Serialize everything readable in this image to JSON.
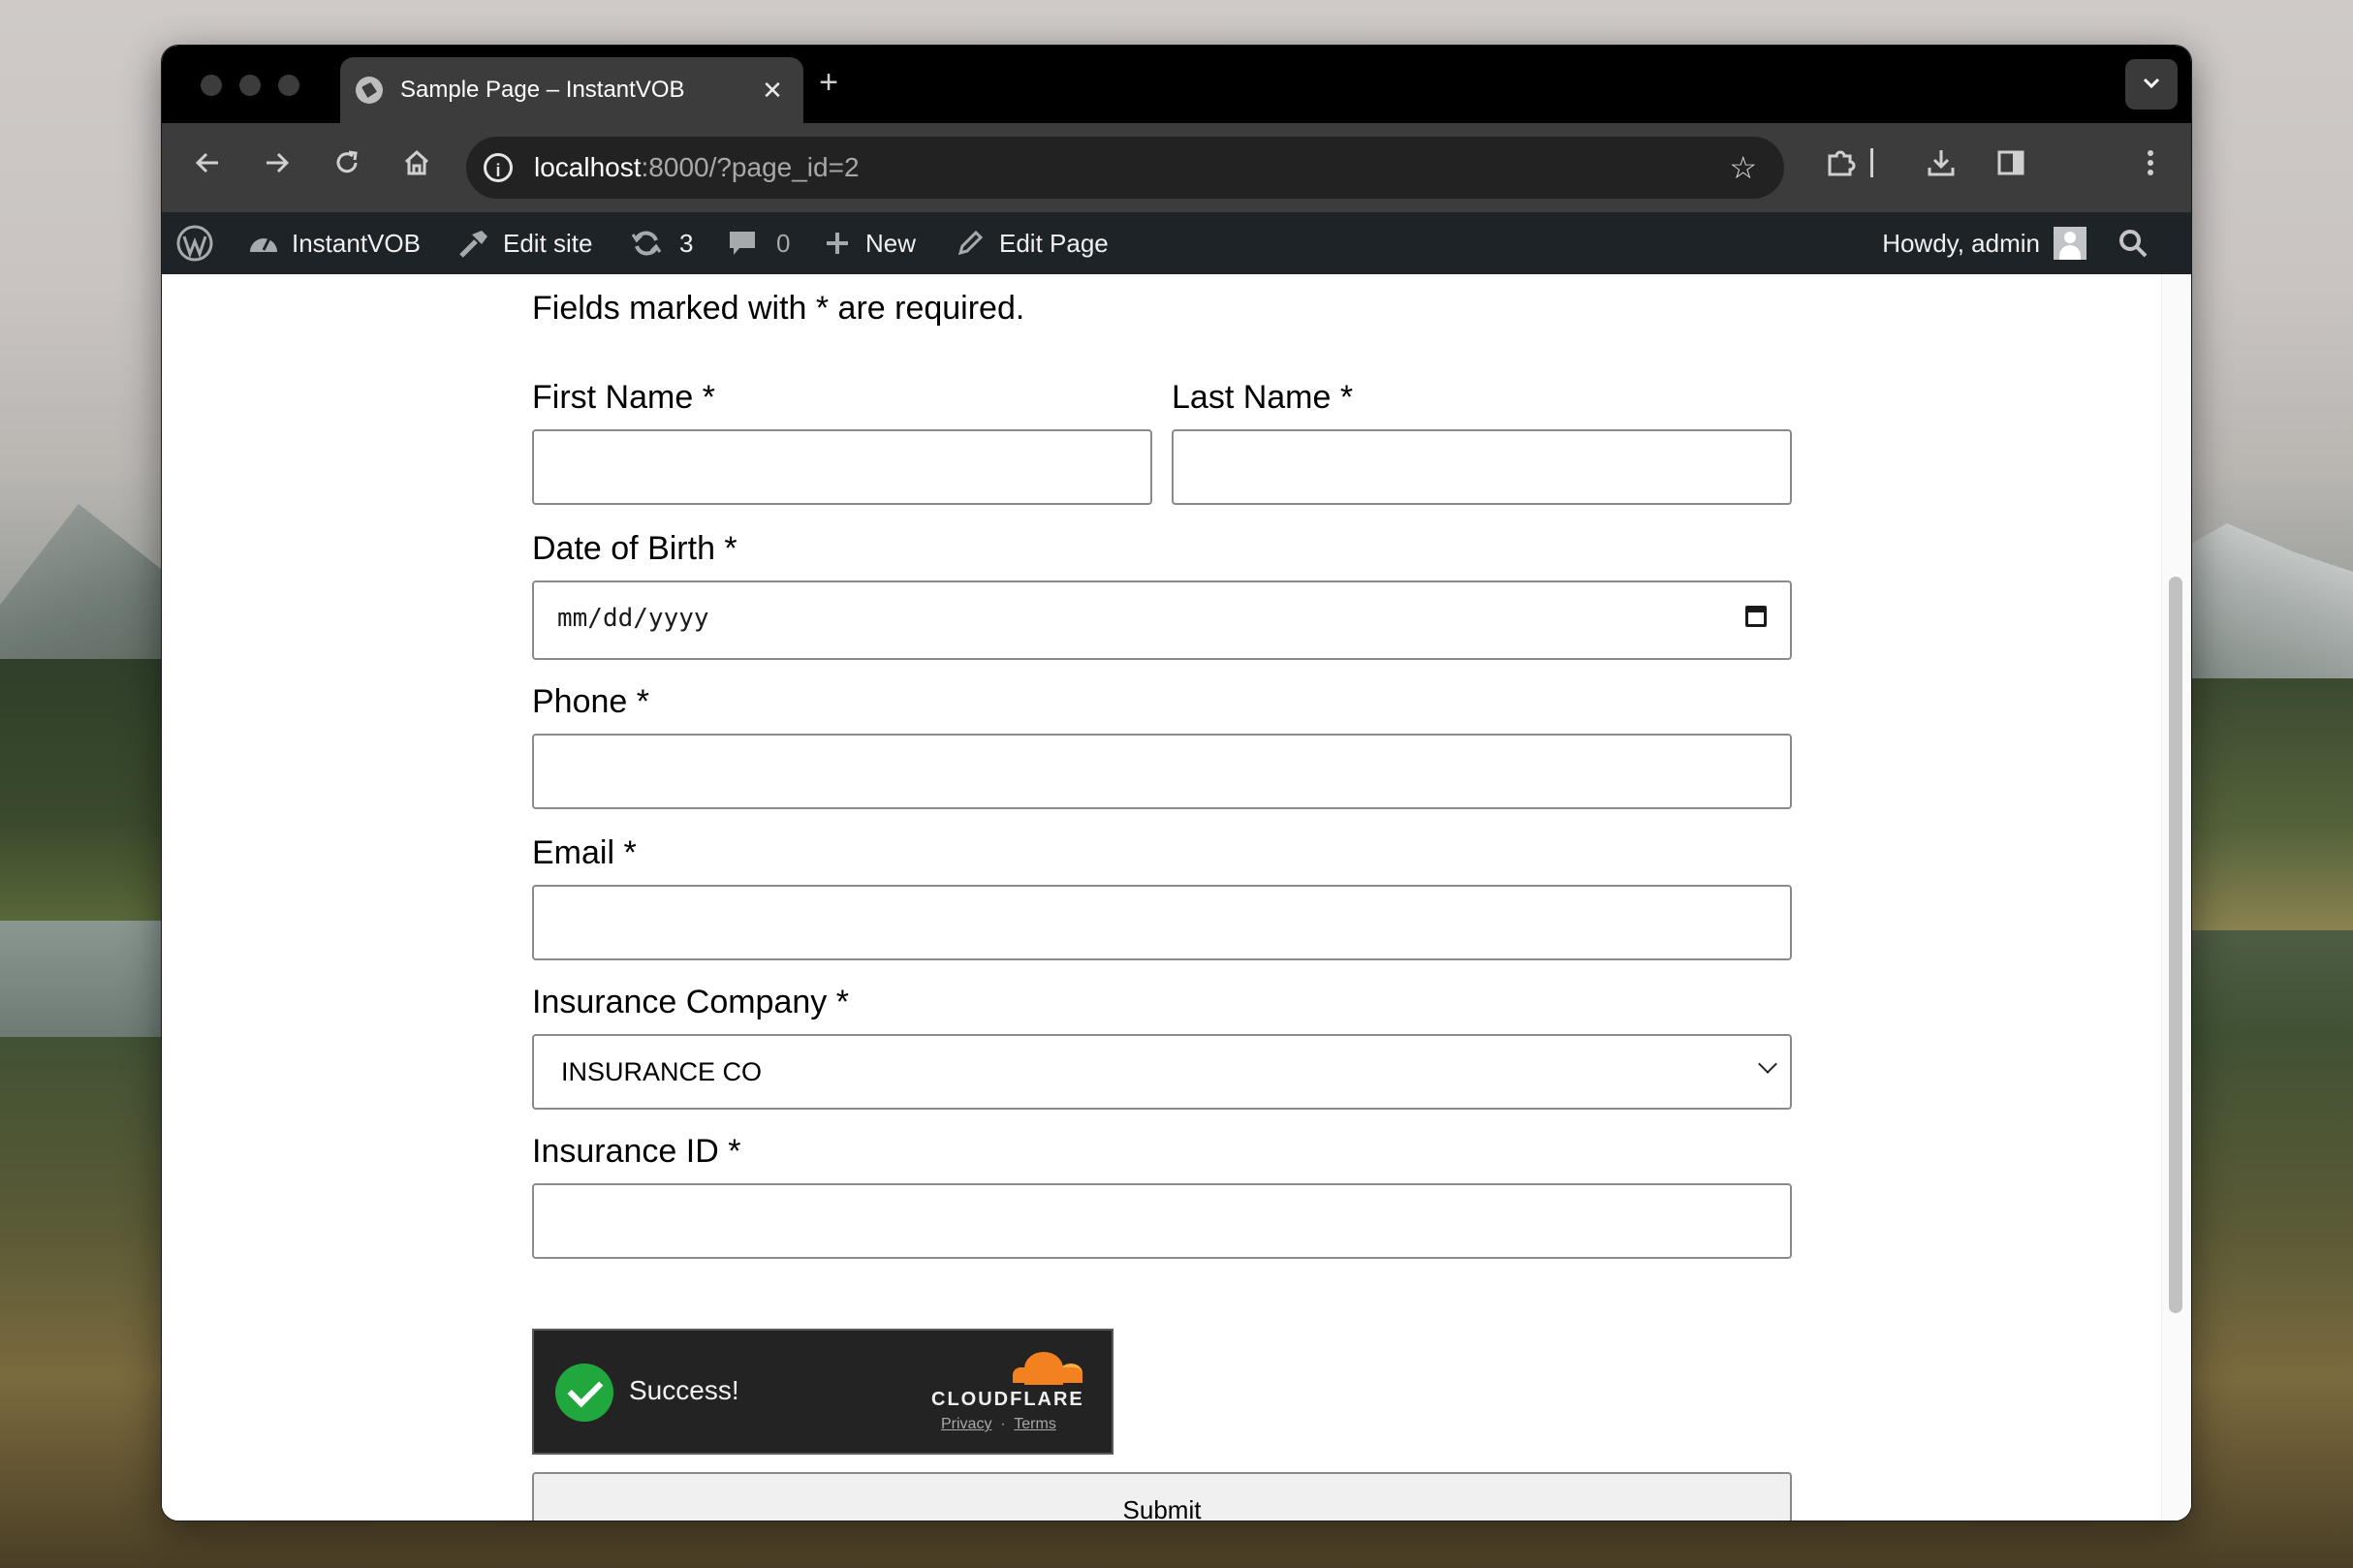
{
  "browser": {
    "tab_title": "Sample Page – InstantVOB",
    "tab_close": "✕",
    "new_tab": "+",
    "url_host": "localhost",
    "url_rest": ":8000/?page_id=2"
  },
  "wp_admin_bar": {
    "site_name": "InstantVOB",
    "edit_site": "Edit site",
    "updates_count": "3",
    "comments_count": "0",
    "new_label": "New",
    "edit_page": "Edit Page",
    "howdy": "Howdy, admin"
  },
  "form": {
    "required_note": "Fields marked with * are required.",
    "first_name_label": "First Name *",
    "last_name_label": "Last Name *",
    "dob_label": "Date of Birth *",
    "dob_placeholder": "mm/dd/yyyy",
    "phone_label": "Phone *",
    "email_label": "Email *",
    "insurance_company_label": "Insurance Company *",
    "insurance_company_value": "INSURANCE CO",
    "insurance_id_label": "Insurance ID *",
    "submit_label": "Submit"
  },
  "turnstile": {
    "status": "Success!",
    "brand": "CLOUDFLARE",
    "privacy": "Privacy",
    "separator": "·",
    "terms": "Terms"
  },
  "colors": {
    "wp_bar": "#1d2327",
    "turnstile_bg": "#232323",
    "success_green": "#20a73d",
    "cloudflare_orange": "#f48120"
  }
}
